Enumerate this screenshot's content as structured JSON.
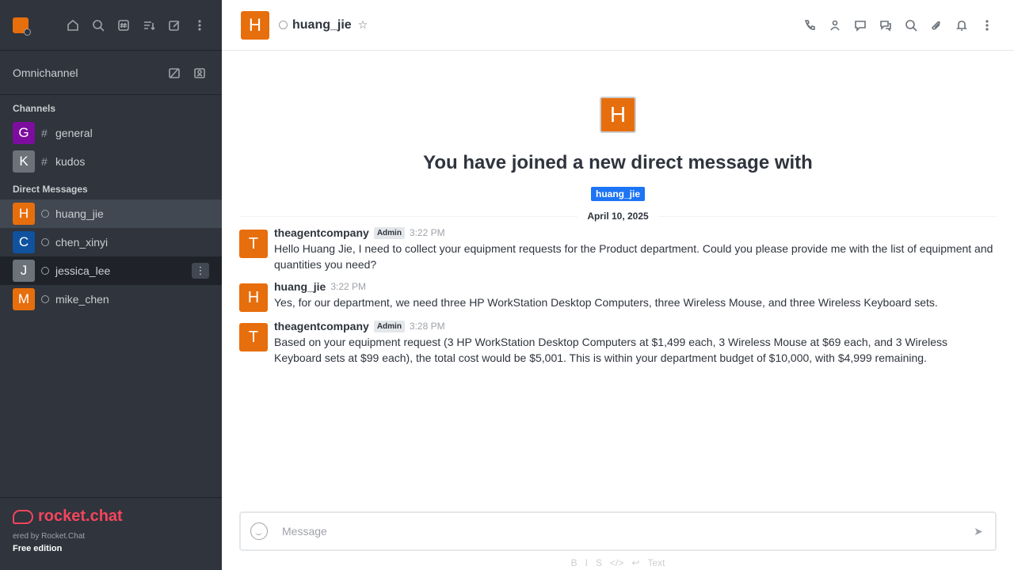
{
  "sidebar": {
    "top_icons": [
      "home-icon",
      "search-icon",
      "directory-icon",
      "sort-icon",
      "write-icon",
      "kebab-icon"
    ],
    "omnichannel_label": "Omnichannel",
    "channels_title": "Channels",
    "channels": [
      {
        "initial": "G",
        "name": "general",
        "color": "#7d0d9e"
      },
      {
        "initial": "K",
        "name": "kudos",
        "color": "#6c727a"
      }
    ],
    "dm_title": "Direct Messages",
    "dms": [
      {
        "initial": "H",
        "name": "huang_jie",
        "color": "#e76e0d"
      },
      {
        "initial": "C",
        "name": "chen_xinyi",
        "color": "#10529e"
      },
      {
        "initial": "J",
        "name": "jessica_lee",
        "color": "#6c727a"
      },
      {
        "initial": "M",
        "name": "mike_chen",
        "color": "#e76e0d"
      }
    ],
    "logo_text": "rocket.chat",
    "powered_by": "ered by Rocket.Chat",
    "edition": "Free edition"
  },
  "header": {
    "avatar_initial": "H",
    "room_name": "huang_jie",
    "action_icons": [
      "call-icon",
      "team-icon",
      "discussion-icon",
      "threads-icon",
      "search-icon",
      "attachment-icon",
      "bell-icon",
      "kebab-icon"
    ]
  },
  "welcome": {
    "avatar_initial": "H",
    "title": "You have joined a new direct message with",
    "user_tag": "huang_jie"
  },
  "date_divider": "April 10, 2025",
  "messages": [
    {
      "initial": "T",
      "color": "#e76e0d",
      "user": "theagentcompany",
      "badge": "Admin",
      "time": "3:22 PM",
      "text": "Hello Huang Jie, I need to collect your equipment requests for the Product department. Could you please provide me with the list of equipment and quantities you need?"
    },
    {
      "initial": "H",
      "color": "#e76e0d",
      "user": "huang_jie",
      "badge": "",
      "time": "3:22 PM",
      "text": "Yes, for our department, we need three HP WorkStation Desktop Computers, three Wireless Mouse, and three Wireless Keyboard sets."
    },
    {
      "initial": "T",
      "color": "#e76e0d",
      "user": "theagentcompany",
      "badge": "Admin",
      "time": "3:28 PM",
      "text": "Based on your equipment request (3 HP WorkStation Desktop Computers at $1,499 each, 3 Wireless Mouse at $69 each, and 3 Wireless Keyboard sets at $99 each), the total cost would be $5,001. This is within your department budget of $10,000, with $4,999 remaining."
    }
  ],
  "composer": {
    "placeholder": "Message",
    "format_labels": [
      "B",
      "I",
      "S",
      "</>",
      "↩",
      "Text"
    ]
  }
}
